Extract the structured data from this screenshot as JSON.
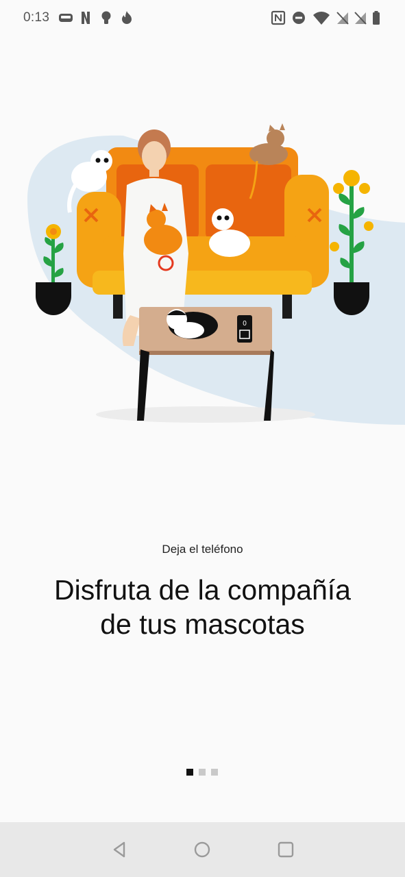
{
  "status_bar": {
    "time": "0:13",
    "left_icons": [
      "gamepad-icon",
      "netflix-n-icon",
      "bulb-icon",
      "fire-icon"
    ],
    "right_icons": [
      "nfc-icon",
      "do-not-disturb-icon",
      "wifi-icon",
      "signal-no-sim-1-icon",
      "signal-no-sim-2-icon",
      "battery-icon"
    ]
  },
  "content": {
    "subtitle": "Deja el teléfono",
    "headline_line1": "Disfruta de la compañía",
    "headline_line2": "de tus mascotas"
  },
  "pager": {
    "total": 3,
    "active_index": 0
  },
  "nav": {
    "buttons": [
      "back-icon",
      "home-icon",
      "recents-icon"
    ]
  },
  "colors": {
    "sofa": "#f28a12",
    "sofa_dark": "#e8650f",
    "blob": "#dde9f2",
    "plant_leaf": "#25a244",
    "pot": "#111111",
    "flower": "#f5b400"
  }
}
